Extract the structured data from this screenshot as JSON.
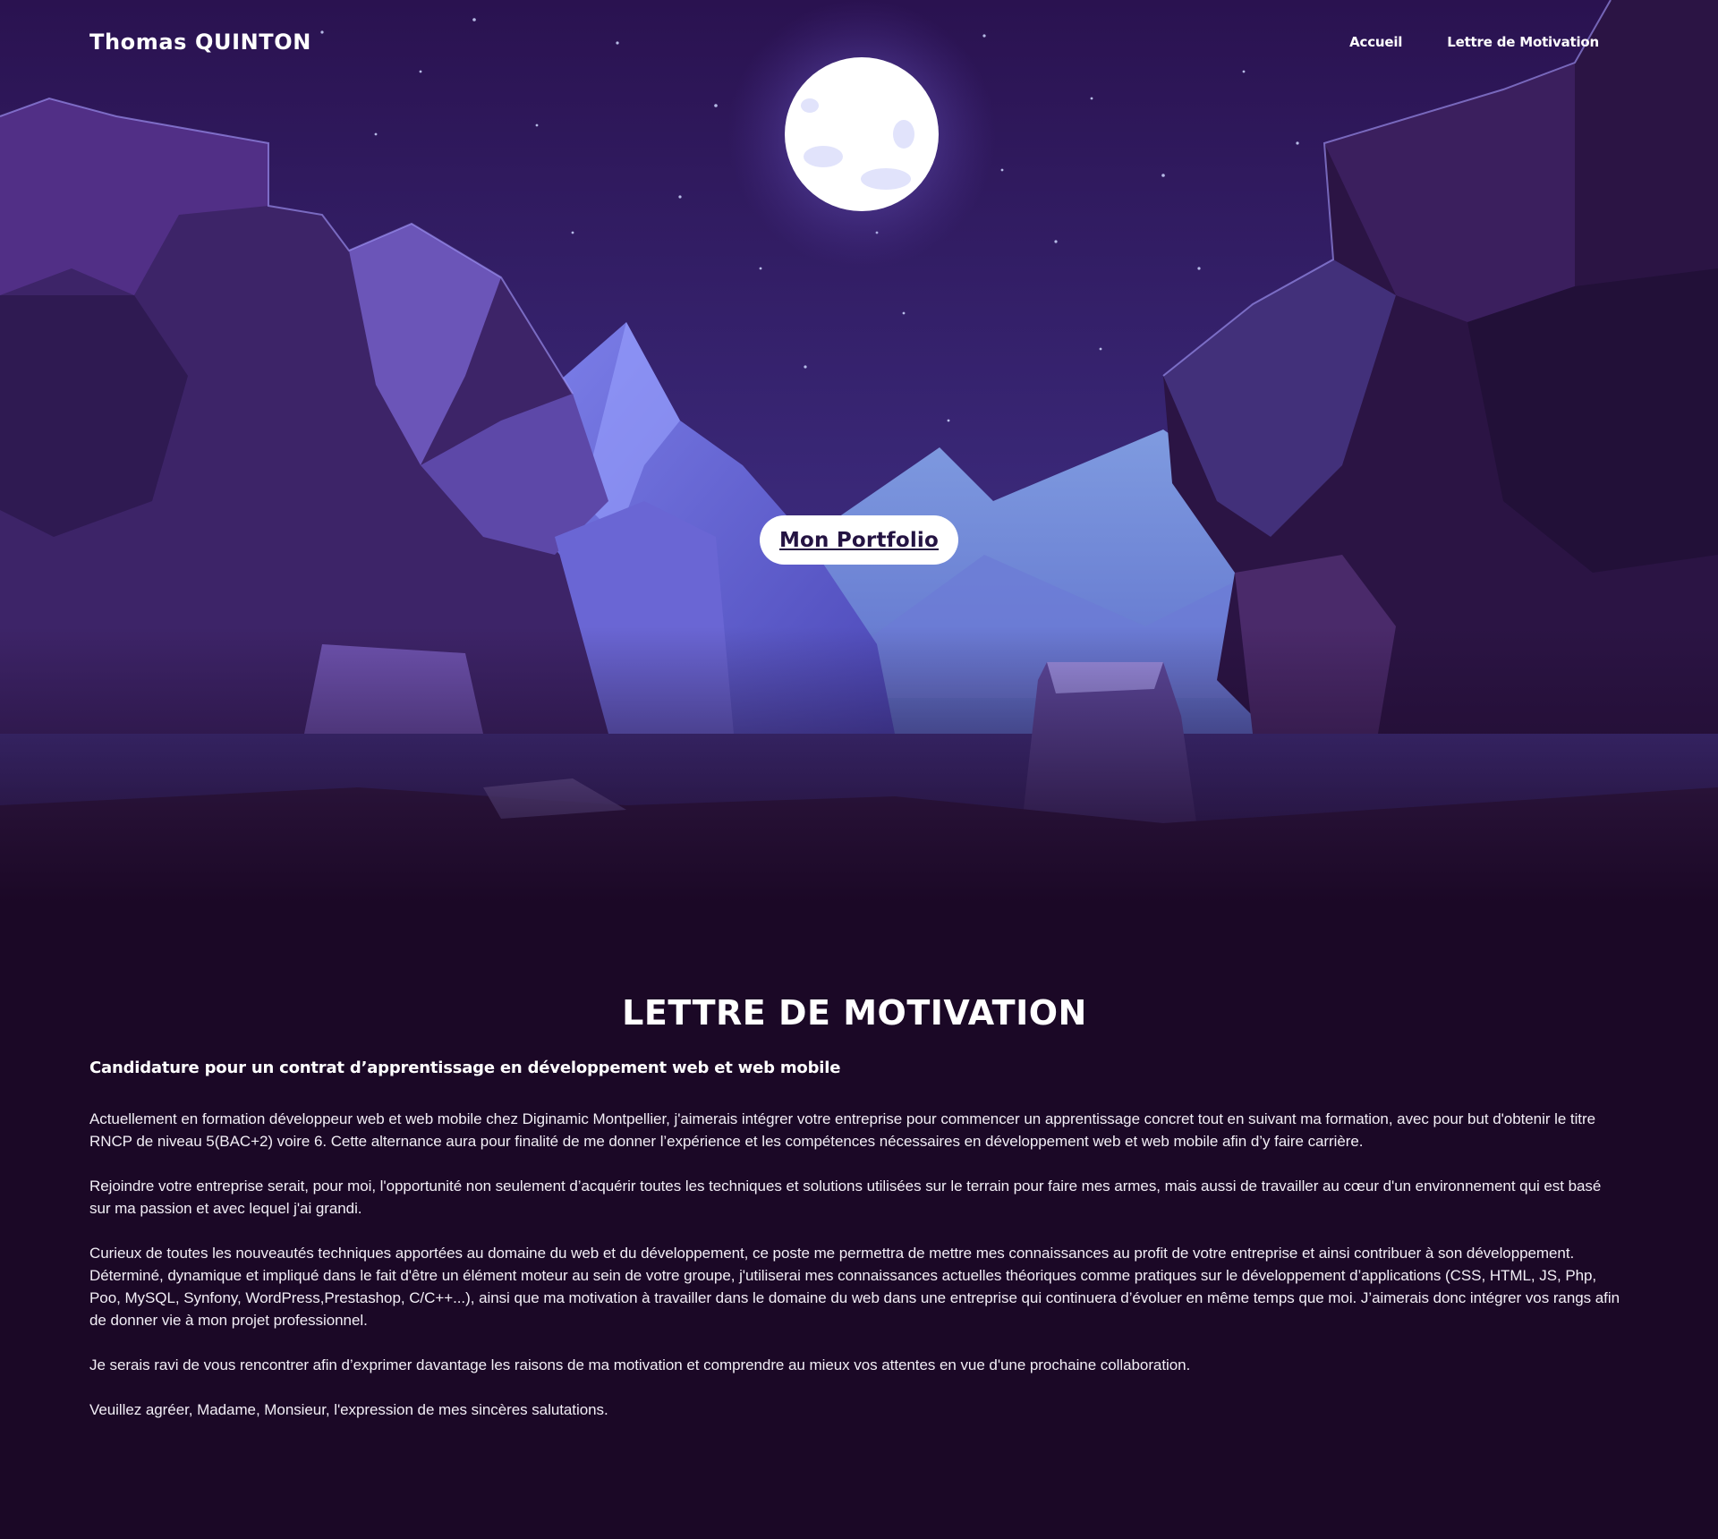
{
  "header": {
    "brand": "Thomas QUINTON",
    "nav": [
      {
        "label": "Accueil"
      },
      {
        "label": "Lettre de Motivation"
      }
    ]
  },
  "hero": {
    "cta_label": "Mon Portfolio",
    "colors": {
      "sky_top": "#2c1553",
      "sky_bottom": "#3b2a7a",
      "moon": "#ffffff",
      "mountain": "#6f7ae0",
      "rock_dark": "#2a1240",
      "rock_mid": "#4a2d7a",
      "page_bg": "#1b0826"
    }
  },
  "letter": {
    "title": "LETTRE DE MOTIVATION",
    "subtitle": "Candidature pour un contrat d’apprentissage en développement web et web mobile",
    "paragraphs": [
      "Actuellement en formation développeur web et web mobile chez Diginamic Montpellier, j'aimerais intégrer votre entreprise pour commencer un apprentissage concret tout en suivant ma formation, avec pour but d'obtenir le titre RNCP de niveau 5(BAC+2) voire 6. Cette alternance aura pour finalité de me donner l’expérience et les compétences nécessaires en développement web et web mobile afin d’y faire carrière.",
      "Rejoindre votre entreprise serait, pour moi, l'opportunité non seulement d’acquérir toutes les techniques et solutions utilisées sur le terrain pour faire mes armes, mais aussi de travailler au cœur d'un environnement qui est basé sur ma passion et avec lequel j'ai grandi.",
      "Curieux de toutes les nouveautés techniques apportées au domaine du web et du développement, ce poste me permettra de mettre mes connaissances au profit de votre entreprise et ainsi contribuer à son développement. Déterminé, dynamique et impliqué dans le fait d'être un élément moteur au sein de votre groupe, j'utiliserai mes connaissances actuelles théoriques comme pratiques sur le développement d’applications (CSS, HTML, JS, Php, Poo, MySQL, Synfony, WordPress,Prestashop, C/C++...), ainsi que ma motivation à travailler dans le domaine du web dans une entreprise qui continuera d’évoluer en même temps que moi. J’aimerais donc intégrer vos rangs afin de donner vie à mon projet professionnel.",
      "Je serais ravi de vous rencontrer afin d’exprimer davantage les raisons de ma motivation et comprendre au mieux vos attentes en vue d'une prochaine collaboration.",
      "Veuillez agréer, Madame, Monsieur, l'expression de mes sincères salutations."
    ]
  }
}
